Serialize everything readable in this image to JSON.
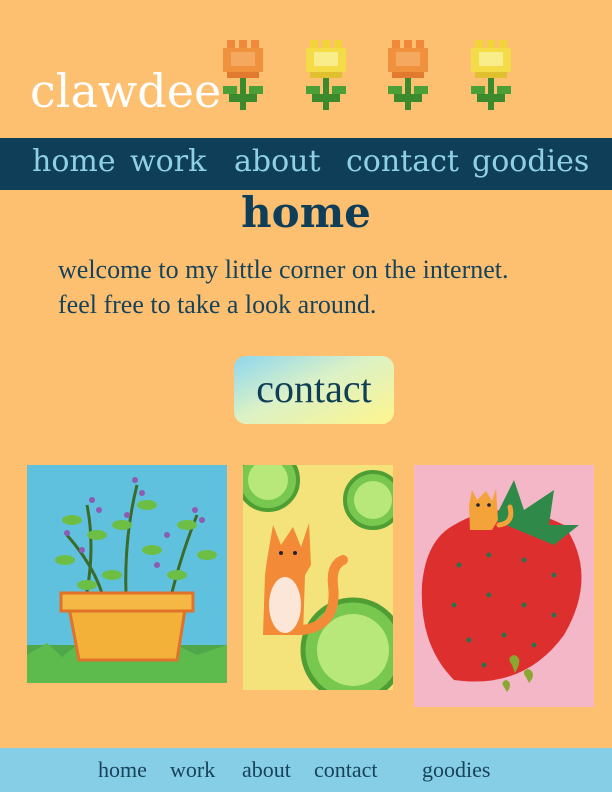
{
  "site": {
    "logo": "clawdee"
  },
  "topnav": {
    "items": [
      "home",
      "work",
      "about",
      "contact",
      "goodies"
    ]
  },
  "main": {
    "title": "home",
    "welcome_line1": "welcome to my little corner on the internet.",
    "welcome_line2": "feel free to take a look around.",
    "cta_label": "contact"
  },
  "gallery": [
    "potted-plant-painting",
    "cat-and-limes-painting",
    "strawberry-and-cat-painting"
  ],
  "footer": {
    "items": [
      "home",
      "work",
      "about",
      "contact",
      "goodies"
    ]
  },
  "colors": {
    "background": "#fdbf70",
    "nav_bar": "#0f3f58",
    "nav_text": "#8fd0e6",
    "footer_bar": "#86cde6",
    "text": "#17435a"
  }
}
